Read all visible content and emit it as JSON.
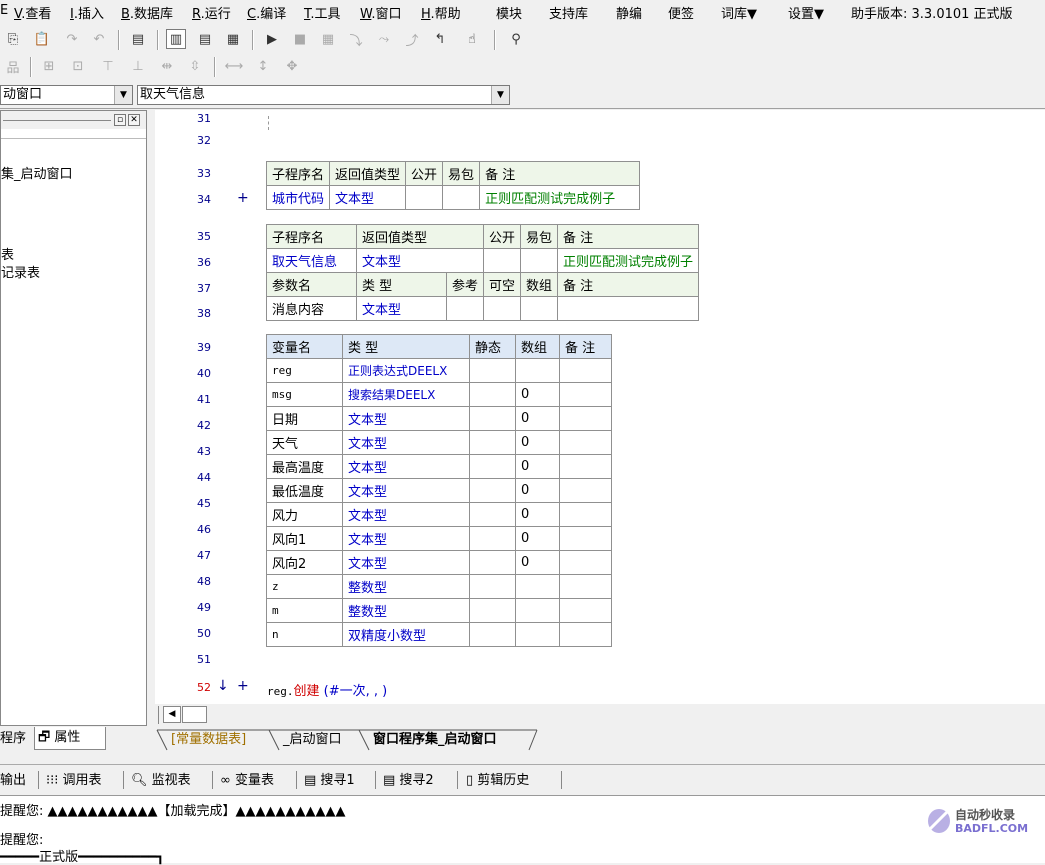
{
  "menu": {
    "items": [
      {
        "prefix": "",
        "key": "",
        "label": "E"
      },
      {
        "prefix": "",
        "key": "V",
        "label": ".查看"
      },
      {
        "prefix": "",
        "key": "I",
        "label": ".插入"
      },
      {
        "prefix": "",
        "key": "B",
        "label": ".数据库"
      },
      {
        "prefix": "",
        "key": "R",
        "label": ".运行"
      },
      {
        "prefix": "",
        "key": "C",
        "label": ".编译"
      },
      {
        "prefix": "",
        "key": "T",
        "label": ".工具"
      },
      {
        "prefix": "",
        "key": "W",
        "label": ".窗口"
      },
      {
        "prefix": "",
        "key": "H",
        "label": ".帮助"
      }
    ],
    "extra": [
      "模块",
      "支持库",
      "静编",
      "便签",
      "词库▼",
      "设置▼",
      "助手版本: 3.3.0101 正式版"
    ]
  },
  "combos": {
    "window": "动窗口",
    "routine": "取天气信息"
  },
  "left_panel": {
    "tree": [
      "集_启动窗口",
      "表",
      "记录表"
    ],
    "tabs": [
      "程序",
      "属性"
    ]
  },
  "editor": {
    "line_numbers": [
      "31",
      "32",
      "33",
      "34",
      "35",
      "36",
      "37",
      "38",
      "39",
      "40",
      "41",
      "42",
      "43",
      "44",
      "45",
      "46",
      "47",
      "48",
      "49",
      "50",
      "51",
      "52"
    ],
    "table1": {
      "headers": [
        "子程序名",
        "返回值类型",
        "公开",
        "易包",
        "备 注"
      ],
      "row": [
        "城市代码",
        "文本型",
        "",
        "",
        "正则匹配测试完成例子"
      ]
    },
    "table2": {
      "headers": [
        "子程序名",
        "返回值类型",
        "公开",
        "易包",
        "备 注"
      ],
      "row": [
        "取天气信息",
        "文本型",
        "",
        "",
        "正则匹配测试完成例子"
      ],
      "param_headers": [
        "参数名",
        "类 型",
        "参考",
        "可空",
        "数组",
        "备 注"
      ],
      "param_row": [
        "消息内容",
        "文本型",
        "",
        "",
        "",
        ""
      ]
    },
    "table3": {
      "headers": [
        "变量名",
        "类 型",
        "静态",
        "数组",
        "备 注"
      ],
      "rows": [
        [
          "reg",
          "正则表达式DEELX",
          "",
          "",
          ""
        ],
        [
          "msg",
          "搜索结果DEELX",
          "",
          "0",
          ""
        ],
        [
          "日期",
          "文本型",
          "",
          "0",
          ""
        ],
        [
          "天气",
          "文本型",
          "",
          "0",
          ""
        ],
        [
          "最高温度",
          "文本型",
          "",
          "0",
          ""
        ],
        [
          "最低温度",
          "文本型",
          "",
          "0",
          ""
        ],
        [
          "风力",
          "文本型",
          "",
          "0",
          ""
        ],
        [
          "风向1",
          "文本型",
          "",
          "0",
          ""
        ],
        [
          "风向2",
          "文本型",
          "",
          "0",
          ""
        ],
        [
          "z",
          "整数型",
          "",
          "",
          ""
        ],
        [
          "m",
          "整数型",
          "",
          "",
          ""
        ],
        [
          "n",
          "双精度小数型",
          "",
          "",
          ""
        ]
      ]
    },
    "code_line_52": {
      "obj": "reg.",
      "method": "创建",
      "args": " (#一次, , )"
    }
  },
  "doc_tabs": [
    "[常量数据表]",
    "_启动窗口",
    "窗口程序集_启动窗口"
  ],
  "bottom_tabs": [
    "输出",
    "调用表",
    "监视表",
    "变量表",
    "搜寻1",
    "搜寻2",
    "剪辑历史"
  ],
  "output": {
    "line1": "提醒您: ▲▲▲▲▲▲▲▲▲▲▲【加载完成】▲▲▲▲▲▲▲▲▲▲▲",
    "line2": "提醒您:",
    "line3": "━━━━━正式版━━━━━━━━━━┓"
  },
  "watermark": {
    "line1": "自动秒收录",
    "line2": "BADFL.COM"
  },
  "colors": {
    "link_blue": "#0000c8",
    "comment_green": "#008000",
    "line_no": "#00008b",
    "header_bg": "#eef6e9"
  }
}
